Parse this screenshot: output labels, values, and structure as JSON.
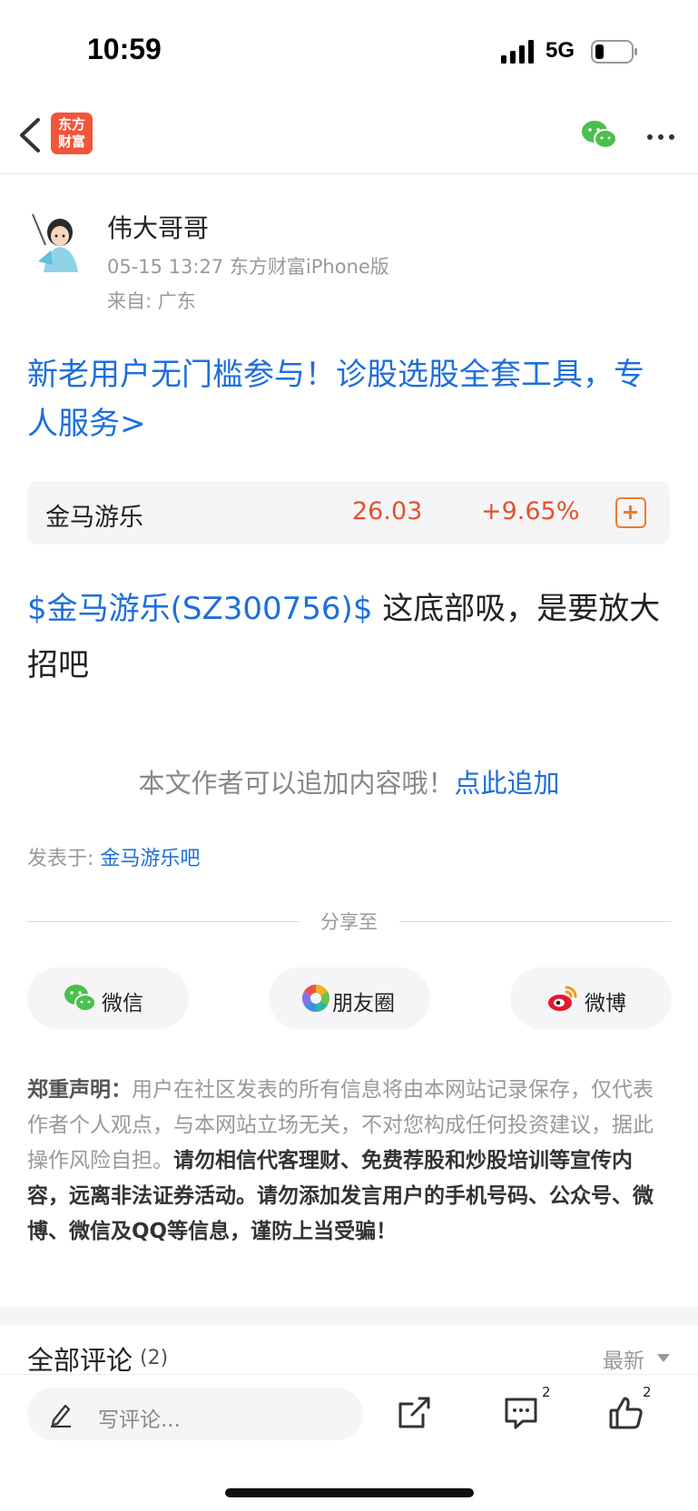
{
  "status": {
    "time": "10:59",
    "network": "5G"
  },
  "nav": {
    "logo_line1": "东方",
    "logo_line2": "财富"
  },
  "author": {
    "name": "伟大哥哥",
    "meta": "05-15 13:27 东方财富iPhone版",
    "location": "来自: 广东"
  },
  "promo": {
    "text": "新老用户无门槛参与！诊股选股全套工具，专人服务>"
  },
  "stock": {
    "name": "金马游乐",
    "price": "26.03",
    "change": "+9.65%"
  },
  "post": {
    "tag": "$金马游乐(SZ300756)$",
    "text": " 这底部吸，是要放大招吧"
  },
  "append": {
    "text": "本文作者可以追加内容哦！",
    "link": "点此追加"
  },
  "posted_in": {
    "label": "发表于: ",
    "bar": "金马游乐吧"
  },
  "share": {
    "title": "分享至",
    "wechat": "微信",
    "moments": "朋友圈",
    "weibo": "微博"
  },
  "disclaimer": {
    "label": "郑重声明：",
    "text": "用户在社区发表的所有信息将由本网站记录保存，仅代表作者个人观点，与本网站立场无关，不对您构成任何投资建议，据此操作风险自担。",
    "warning": "请勿相信代客理财、免费荐股和炒股培训等宣传内容，远离非法证券活动。请勿添加发言用户的手机号码、公众号、微博、微信及QQ等信息，谨防上当受骗！"
  },
  "comments": {
    "title": "全部评论",
    "count": "(2)",
    "sort": "最新"
  },
  "bottom": {
    "placeholder": "写评论...",
    "comment_badge": "2",
    "like_badge": "2"
  },
  "colors": {
    "link": "#1d6fdb",
    "up": "#e5512c",
    "brand": "#f2553a"
  }
}
